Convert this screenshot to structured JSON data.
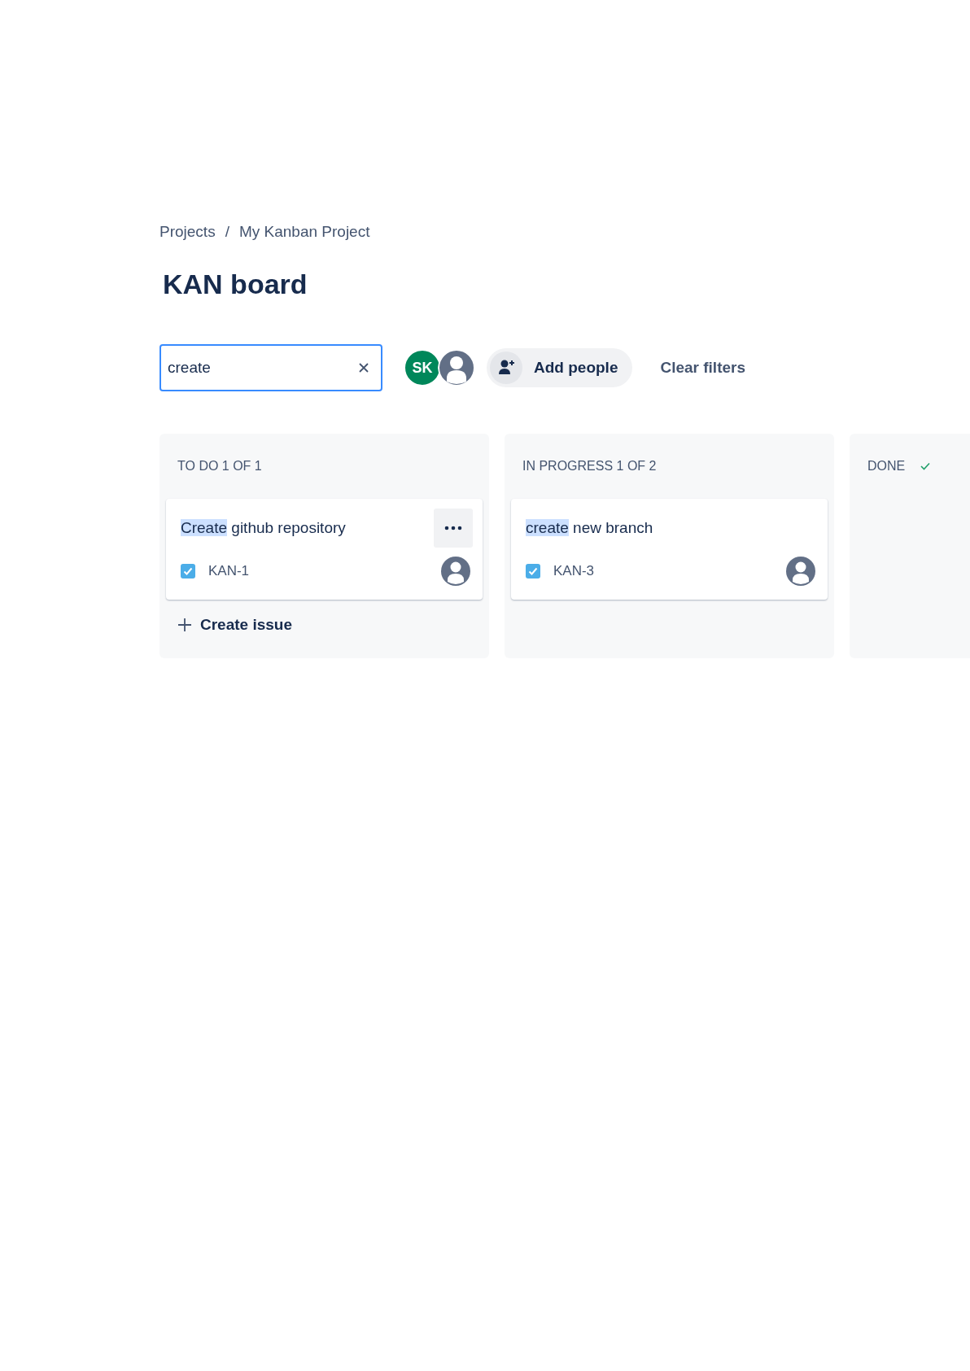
{
  "breadcrumbs": [
    "Projects",
    "My Kanban Project"
  ],
  "breadcrumb_separator": "/",
  "title": "KAN board",
  "search": {
    "value": "create"
  },
  "avatars": [
    {
      "kind": "initials",
      "text": "SK",
      "color": "#00875a"
    },
    {
      "kind": "silhouette",
      "color": "#626f86"
    }
  ],
  "add_people": "Add people",
  "clear_filters": "Clear filters",
  "columns": [
    {
      "title": "TO DO 1 OF 1",
      "done": false,
      "cards": [
        {
          "match": "Create",
          "rest": " github repository",
          "key": "KAN-1",
          "menu": true
        }
      ],
      "create_issue": "Create issue"
    },
    {
      "title": "IN PROGRESS 1 OF 2",
      "done": false,
      "cards": [
        {
          "match": "create",
          "rest": " new branch",
          "key": "KAN-3",
          "menu": false
        }
      ]
    },
    {
      "title": "DONE",
      "done": true
    }
  ]
}
